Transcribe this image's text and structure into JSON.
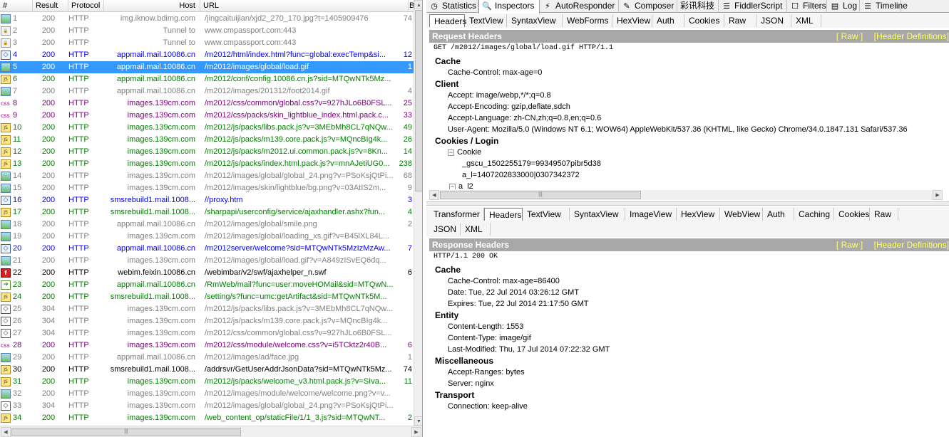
{
  "grid": {
    "columns": {
      "num": "#",
      "result": "Result",
      "protocol": "Protocol",
      "host": "Host",
      "url": "URL",
      "body": "B"
    }
  },
  "sessions": [
    {
      "num": "1",
      "result": "200",
      "protocol": "HTTP",
      "host": "img.iknow.bdimg.com",
      "url": "/jingcaituijian/xjd2_270_170.jpg?t=1405909476",
      "body": "74",
      "color": "gray",
      "icon": "image-icon"
    },
    {
      "num": "2",
      "result": "200",
      "protocol": "HTTP",
      "host": "Tunnel to",
      "url": "www.cmpassport.com:443",
      "body": "",
      "color": "gray",
      "icon": "lock-icon"
    },
    {
      "num": "3",
      "result": "200",
      "protocol": "HTTP",
      "host": "Tunnel to",
      "url": "www.cmpassport.com:443",
      "body": "",
      "color": "gray",
      "icon": "lock-icon"
    },
    {
      "num": "4",
      "result": "200",
      "protocol": "HTTP",
      "host": "appmail.mail.10086.cn",
      "url": "/m2012/html/index.html?func=global:execTemp&si...",
      "body": "12",
      "color": "blue",
      "icon": "html-icon"
    },
    {
      "num": "5",
      "result": "200",
      "protocol": "HTTP",
      "host": "appmail.mail.10086.cn",
      "url": "/m2012/images/global/load.gif",
      "body": "1",
      "color": "black",
      "icon": "image-icon",
      "selected": true
    },
    {
      "num": "6",
      "result": "200",
      "protocol": "HTTP",
      "host": "appmail.mail.10086.cn",
      "url": "/m2012/conf/config.10086.cn.js?sid=MTQwNTk5Mz...",
      "body": "",
      "color": "green",
      "icon": "script-icon"
    },
    {
      "num": "7",
      "result": "200",
      "protocol": "HTTP",
      "host": "appmail.mail.10086.cn",
      "url": "/m2012/images/201312/foot2014.gif",
      "body": "4",
      "color": "gray",
      "icon": "image-icon"
    },
    {
      "num": "8",
      "result": "200",
      "protocol": "HTTP",
      "host": "images.139cm.com",
      "url": "/m2012/css/common/global.css?v=927hJLo6B0FSL...",
      "body": "25",
      "color": "purple",
      "icon": "css-icon"
    },
    {
      "num": "9",
      "result": "200",
      "protocol": "HTTP",
      "host": "images.139cm.com",
      "url": "/m2012/css/packs/skin_lightblue_index.html.pack.c...",
      "body": "33",
      "color": "purple",
      "icon": "css-icon"
    },
    {
      "num": "10",
      "result": "200",
      "protocol": "HTTP",
      "host": "images.139cm.com",
      "url": "/m2012/js/packs/libs.pack.js?v=3MEbMh8CL7qNQw...",
      "body": "49",
      "color": "green",
      "icon": "script-icon"
    },
    {
      "num": "11",
      "result": "200",
      "protocol": "HTTP",
      "host": "images.139cm.com",
      "url": "/m2012/js/packs/m139.core.pack.js?v=MQncBIg4k...",
      "body": "26",
      "color": "green",
      "icon": "script-icon"
    },
    {
      "num": "12",
      "result": "200",
      "protocol": "HTTP",
      "host": "images.139cm.com",
      "url": "/m2012/js/packs/m2012.ui.common.pack.js?v=8Kn...",
      "body": "14",
      "color": "green",
      "icon": "script-icon"
    },
    {
      "num": "13",
      "result": "200",
      "protocol": "HTTP",
      "host": "images.139cm.com",
      "url": "/m2012/js/packs/index.html.pack.js?v=mnAJetiUG0...",
      "body": "238",
      "color": "green",
      "icon": "script-icon"
    },
    {
      "num": "14",
      "result": "200",
      "protocol": "HTTP",
      "host": "images.139cm.com",
      "url": "/m2012/images/global/global_24.png?v=PSoKsjQtPi...",
      "body": "68",
      "color": "gray",
      "icon": "image-icon"
    },
    {
      "num": "15",
      "result": "200",
      "protocol": "HTTP",
      "host": "images.139cm.com",
      "url": "/m2012/images/skin/lightblue/bg.png?v=03AtIS2m...",
      "body": "9",
      "color": "gray",
      "icon": "image-icon"
    },
    {
      "num": "16",
      "result": "200",
      "protocol": "HTTP",
      "host": "smsrebuild1.mail.1008...",
      "url": "//proxy.htm",
      "body": "3",
      "color": "blue",
      "icon": "html-icon"
    },
    {
      "num": "17",
      "result": "200",
      "protocol": "HTTP",
      "host": "smsrebuild1.mail.1008...",
      "url": "/sharpapi/userconfig/service/ajaxhandler.ashx?fun...",
      "body": "4",
      "color": "green",
      "icon": "script-icon"
    },
    {
      "num": "18",
      "result": "200",
      "protocol": "HTTP",
      "host": "appmail.mail.10086.cn",
      "url": "/m2012/images/global/smile.png",
      "body": "2",
      "color": "gray",
      "icon": "image-icon"
    },
    {
      "num": "19",
      "result": "200",
      "protocol": "HTTP",
      "host": "images.139cm.com",
      "url": "/m2012/images/global/loading_xs.gif?v=B45lXL84L...",
      "body": "",
      "color": "gray",
      "icon": "image-icon"
    },
    {
      "num": "20",
      "result": "200",
      "protocol": "HTTP",
      "host": "appmail.mail.10086.cn",
      "url": "/m2012server/welcome?sid=MTQwNTk5MzIzMzAw...",
      "body": "7",
      "color": "blue",
      "icon": "html-icon"
    },
    {
      "num": "21",
      "result": "200",
      "protocol": "HTTP",
      "host": "images.139cm.com",
      "url": "/m2012/images/global/load.gif?v=A849zISvEQ6dq...",
      "body": "",
      "color": "gray",
      "icon": "image-icon"
    },
    {
      "num": "22",
      "result": "200",
      "protocol": "HTTP",
      "host": "webim.feixin.10086.cn",
      "url": "/webimbar/v2/swf/ajaxhelper_n.swf",
      "body": "6",
      "color": "black",
      "icon": "flash-icon"
    },
    {
      "num": "23",
      "result": "200",
      "protocol": "HTTP",
      "host": "appmail.mail.10086.cn",
      "url": "/RmWeb/mail?func=user:moveHOMail&sid=MTQwN...",
      "body": "",
      "color": "green",
      "icon": "post-icon"
    },
    {
      "num": "24",
      "result": "200",
      "protocol": "HTTP",
      "host": "smsrebuild1.mail.1008...",
      "url": "/setting/s?func=umc:getArtifact&sid=MTQwNTk5M...",
      "body": "",
      "color": "green",
      "icon": "script-icon"
    },
    {
      "num": "25",
      "result": "304",
      "protocol": "HTTP",
      "host": "images.139cm.com",
      "url": "/m2012/js/packs/libs.pack.js?v=3MEbMh8CL7qNQw...",
      "body": "",
      "color": "gray",
      "icon": "not-modified-icon"
    },
    {
      "num": "26",
      "result": "304",
      "protocol": "HTTP",
      "host": "images.139cm.com",
      "url": "/m2012/js/packs/m139.core.pack.js?v=MQncBIg4k...",
      "body": "",
      "color": "gray",
      "icon": "not-modified-icon"
    },
    {
      "num": "27",
      "result": "304",
      "protocol": "HTTP",
      "host": "images.139cm.com",
      "url": "/m2012/css/common/global.css?v=927hJLo6B0FSL...",
      "body": "",
      "color": "gray",
      "icon": "not-modified-icon"
    },
    {
      "num": "28",
      "result": "200",
      "protocol": "HTTP",
      "host": "images.139cm.com",
      "url": "/m2012/css/module/welcome.css?v=i5TCktz2r40B...",
      "body": "6",
      "color": "purple",
      "icon": "css-icon"
    },
    {
      "num": "29",
      "result": "200",
      "protocol": "HTTP",
      "host": "appmail.mail.10086.cn",
      "url": "/m2012/images/ad/face.jpg",
      "body": "1",
      "color": "gray",
      "icon": "image-icon"
    },
    {
      "num": "30",
      "result": "200",
      "protocol": "HTTP",
      "host": "smsrebuild1.mail.1008...",
      "url": "/addrsvr/GetUserAddrJsonData?sid=MTQwNTk5Mz...",
      "body": "74",
      "color": "black",
      "icon": "script-icon"
    },
    {
      "num": "31",
      "result": "200",
      "protocol": "HTTP",
      "host": "images.139cm.com",
      "url": "/m2012/js/packs/welcome_v3.html.pack.js?v=SIva...",
      "body": "11",
      "color": "green",
      "icon": "script-icon"
    },
    {
      "num": "32",
      "result": "200",
      "protocol": "HTTP",
      "host": "images.139cm.com",
      "url": "/m2012/images/module/welcome/welcome.png?v=v...",
      "body": "",
      "color": "gray",
      "icon": "image-icon"
    },
    {
      "num": "33",
      "result": "304",
      "protocol": "HTTP",
      "host": "images.139cm.com",
      "url": "/m2012/images/global/global_24.png?v=PSoKsjQtPi...",
      "body": "",
      "color": "gray",
      "icon": "not-modified-icon"
    },
    {
      "num": "34",
      "result": "200",
      "protocol": "HTTP",
      "host": "images.139cm.com",
      "url": "/web_content_op/staticFile/1/1_3.js?sid=MTQwNT...",
      "body": "2",
      "color": "green",
      "icon": "script-icon"
    }
  ],
  "colors": {
    "gray": "#808080",
    "green": "#008000",
    "blue": "#0000ff",
    "purple": "#800080",
    "black": "#000000",
    "selected": "#3399ff",
    "section": "#a8a8a8",
    "links": "#ffff66"
  },
  "main_tabs": [
    {
      "label": "Statistics",
      "icon": "stopwatch-icon",
      "glyph": "◷"
    },
    {
      "label": "Inspectors",
      "icon": "magnifier-icon",
      "glyph": "🔍",
      "active": true
    },
    {
      "label": "AutoResponder",
      "icon": "lightning-icon",
      "glyph": "⚡"
    },
    {
      "label": "Composer",
      "icon": "pencil-icon",
      "glyph": "✎"
    },
    {
      "label": "彩讯科技",
      "icon": "",
      "glyph": ""
    },
    {
      "label": "FiddlerScript",
      "icon": "script-icon",
      "glyph": "☰"
    },
    {
      "label": "Filters",
      "icon": "checkbox-icon",
      "glyph": "☐"
    },
    {
      "label": "Log",
      "icon": "document-icon",
      "glyph": "▤"
    },
    {
      "label": "Timeline",
      "icon": "timeline-icon",
      "glyph": "☰"
    }
  ],
  "request": {
    "tabs": [
      "Headers",
      "TextView",
      "SyntaxView",
      "WebForms",
      "HexView",
      "Auth",
      "Cookies",
      "Raw",
      "JSON",
      "XML"
    ],
    "section_title": "Request Headers",
    "raw_link": "[ Raw ]",
    "defs_link": "[Header Definitions]",
    "first_line": "GET /m2012/images/global/load.gif HTTP/1.1",
    "groups": [
      {
        "name": "Cache",
        "items": [
          "Cache-Control: max-age=0"
        ]
      },
      {
        "name": "Client",
        "items": [
          "Accept: image/webp,*/*;q=0.8",
          "Accept-Encoding: gzip,deflate,sdch",
          "Accept-Language: zh-CN,zh;q=0.8,en;q=0.6",
          "User-Agent: Mozilla/5.0 (Windows NT 6.1; WOW64) AppleWebKit/537.36 (KHTML, like Gecko) Chrome/34.0.1847.131 Safari/537.36"
        ]
      },
      {
        "name": "Cookies / Login",
        "items": []
      }
    ],
    "cookie_label": "Cookie",
    "cookie_items": [
      "_gscu_1502255179=99349507pibr5d38",
      "a_l=1407202833000|0307342372"
    ],
    "cookie_sub": "a_l2"
  },
  "response": {
    "tabs_row1": [
      "Transformer",
      "Headers",
      "TextView",
      "SyntaxView",
      "ImageView",
      "HexView",
      "WebView",
      "Auth",
      "Caching",
      "Cookies",
      "Raw"
    ],
    "tabs_row2": [
      "JSON",
      "XML"
    ],
    "section_title": "Response Headers",
    "raw_link": "[ Raw ]",
    "defs_link": "[Header Definitions]",
    "first_line": "HTTP/1.1 200 OK",
    "groups": [
      {
        "name": "Cache",
        "items": [
          "Cache-Control: max-age=86400",
          "Date: Tue, 22 Jul 2014 03:26:12 GMT",
          "Expires: Tue, 22 Jul 2014 21:17:50 GMT"
        ]
      },
      {
        "name": "Entity",
        "items": [
          "Content-Length: 1553",
          "Content-Type: image/gif",
          "Last-Modified: Thu, 17 Jul 2014 07:22:32 GMT"
        ]
      },
      {
        "name": "Miscellaneous",
        "items": [
          "Accept-Ranges: bytes",
          "Server: nginx"
        ]
      },
      {
        "name": "Transport",
        "items": [
          "Connection: keep-alive"
        ]
      }
    ]
  }
}
